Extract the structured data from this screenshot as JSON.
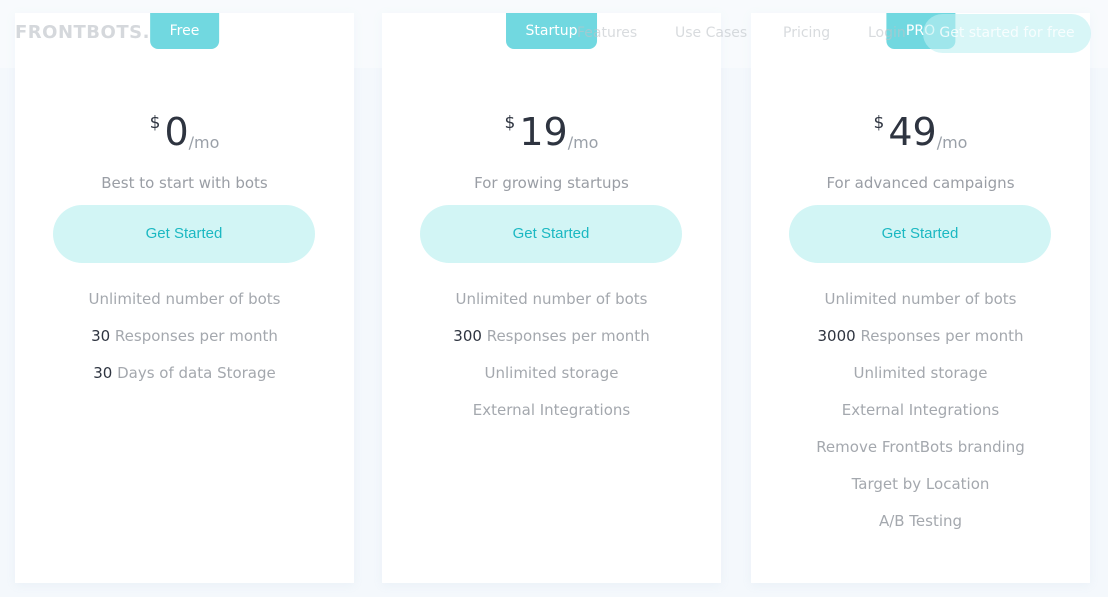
{
  "header": {
    "logo": "FRONTBOTS.",
    "nav": [
      "Features",
      "Use Cases",
      "Pricing",
      "Login"
    ],
    "cta": "Get started for free"
  },
  "plans": [
    {
      "tab": "Free",
      "currency": "$",
      "amount": "0",
      "period": "/mo",
      "subtitle": "Best to start with bots",
      "button": "Get Started",
      "features": [
        {
          "strong": "",
          "text": "Unlimited number of bots"
        },
        {
          "strong": "30",
          "text": " Responses per month"
        },
        {
          "strong": "30",
          "text": " Days of data Storage"
        }
      ]
    },
    {
      "tab": "Startup",
      "currency": "$",
      "amount": "19",
      "period": "/mo",
      "subtitle": "For growing startups",
      "button": "Get Started",
      "features": [
        {
          "strong": "",
          "text": "Unlimited number of bots"
        },
        {
          "strong": "300",
          "text": " Responses per month"
        },
        {
          "strong": "",
          "text": "Unlimited storage"
        },
        {
          "strong": "",
          "text": "External Integrations"
        }
      ]
    },
    {
      "tab": "PRO",
      "currency": "$",
      "amount": "49",
      "period": "/mo",
      "subtitle": "For advanced campaigns",
      "button": "Get Started",
      "features": [
        {
          "strong": "",
          "text": "Unlimited number of bots"
        },
        {
          "strong": "3000",
          "text": " Responses per month"
        },
        {
          "strong": "",
          "text": "Unlimited storage"
        },
        {
          "strong": "",
          "text": "External Integrations"
        },
        {
          "strong": "",
          "text": "Remove FrontBots branding"
        },
        {
          "strong": "",
          "text": "Target by Location"
        },
        {
          "strong": "",
          "text": "A/B Testing"
        }
      ]
    }
  ],
  "colors": {
    "accent": "#26c4cf",
    "button_bg": "#d2f5f5",
    "button_text": "#1bb8c2"
  }
}
